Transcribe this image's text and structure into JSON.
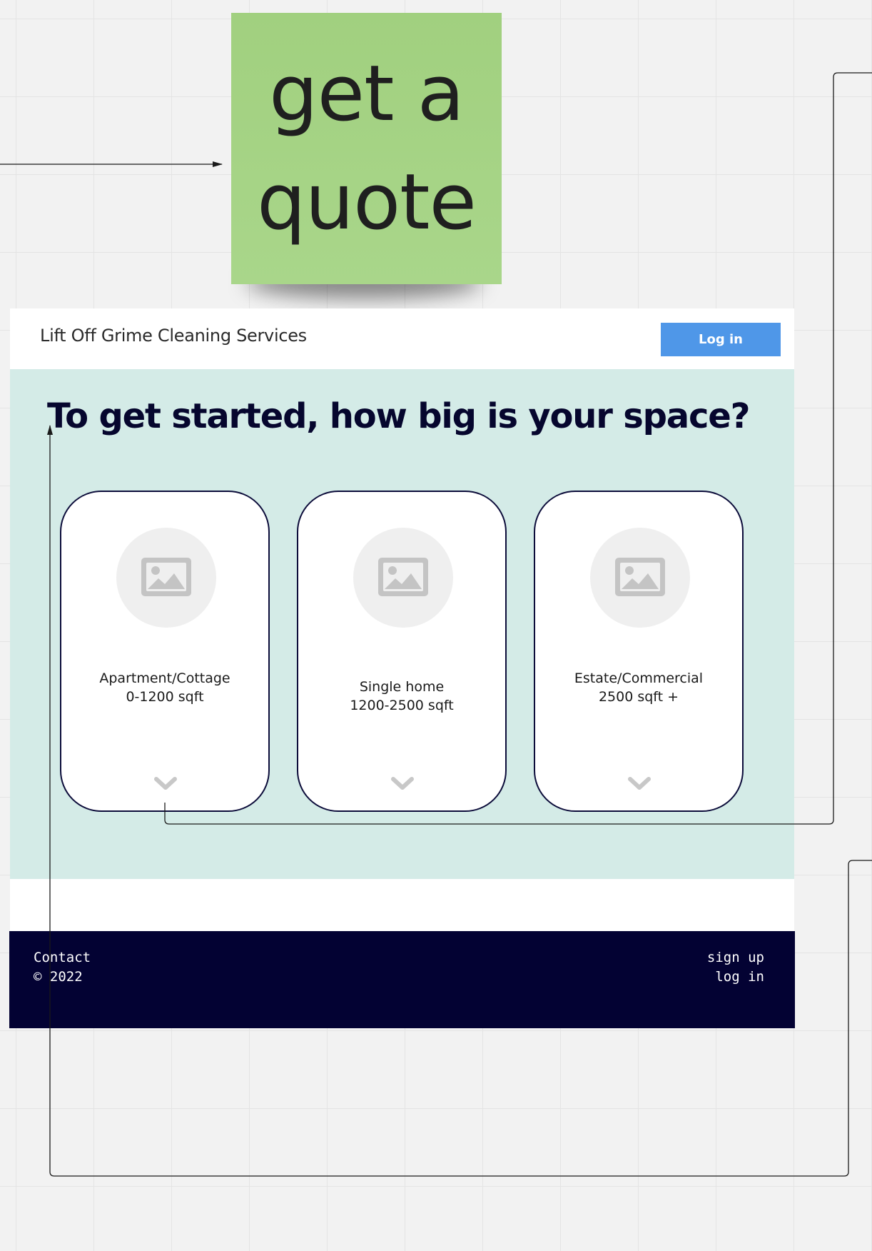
{
  "sticky_note": {
    "text": "get a quote",
    "color": "#a5d384"
  },
  "site": {
    "brand": "Lift Off Grime Cleaning Services",
    "login_label": "Log in",
    "login_color": "#4f97e8"
  },
  "main": {
    "heading": "To get started, how big is your space?",
    "background": "#d4ebe7",
    "cards": [
      {
        "title": "Apartment/Cottage",
        "size": "0-1200 sqft",
        "image_icon": "image-placeholder-icon",
        "expand_icon": "chevron-down-icon"
      },
      {
        "title": "Single home",
        "size": "1200-2500 sqft",
        "image_icon": "image-placeholder-icon",
        "expand_icon": "chevron-down-icon"
      },
      {
        "title": "Estate/Commercial",
        "size": "2500 sqft +",
        "image_icon": "image-placeholder-icon",
        "expand_icon": "chevron-down-icon"
      }
    ]
  },
  "footer": {
    "contact": "Contact",
    "copyright": "© 2022",
    "signup": "sign up",
    "login": "log in",
    "background": "#030233"
  }
}
